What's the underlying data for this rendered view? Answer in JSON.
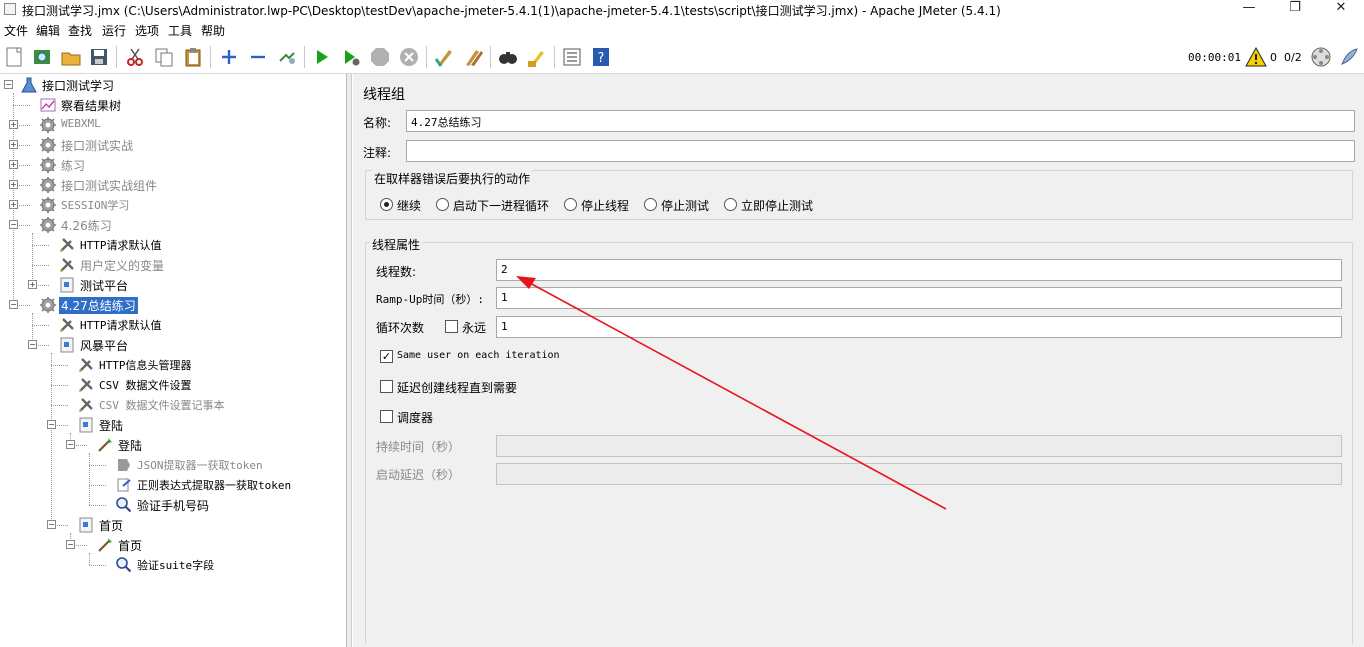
{
  "window": {
    "title": "接口测试学习.jmx (C:\\Users\\Administrator.lwp-PC\\Desktop\\testDev\\apache-jmeter-5.4.1(1)\\apache-jmeter-5.4.1\\tests\\script\\接口测试学习.jmx) - Apache JMeter (5.4.1)",
    "minimize": "—",
    "maximize": "❐",
    "close": "✕"
  },
  "menu": [
    "文件",
    "编辑",
    "查找",
    "运行",
    "选项",
    "工具",
    "帮助"
  ],
  "toolbar": {
    "icons": [
      "new-icon",
      "templates-icon",
      "open-icon",
      "save-icon",
      "cut-icon",
      "copy-icon",
      "paste-icon",
      "expand-icon",
      "collapse-icon",
      "toggle-icon",
      "start-icon",
      "start-no-pause-icon",
      "stop-icon",
      "shutdown-icon",
      "clear-icon",
      "clear-all-icon",
      "search-icon",
      "reset-search-icon",
      "function-helper-icon",
      "help-icon"
    ],
    "elapsed": "00:00:01",
    "warnings": "0",
    "threads": "0/2"
  },
  "tree": {
    "nodes": [
      {
        "label": "接口测试学习",
        "icon": "test-plan-icon",
        "depth": 0,
        "expander": "−",
        "style": "normal"
      },
      {
        "label": "察看结果树",
        "icon": "listener-icon",
        "depth": 1,
        "expander": "",
        "style": "normal"
      },
      {
        "label": "WEBXML",
        "icon": "thread-group-icon",
        "depth": 1,
        "expander": "+",
        "style": "disabled"
      },
      {
        "label": "接口测试实战",
        "icon": "thread-group-icon",
        "depth": 1,
        "expander": "+",
        "style": "disabled"
      },
      {
        "label": "练习",
        "icon": "thread-group-icon",
        "depth": 1,
        "expander": "+",
        "style": "disabled"
      },
      {
        "label": "接口测试实战组件",
        "icon": "thread-group-icon",
        "depth": 1,
        "expander": "+",
        "style": "disabled"
      },
      {
        "label": "SESSION学习",
        "icon": "thread-group-icon",
        "depth": 1,
        "expander": "+",
        "style": "disabled"
      },
      {
        "label": "4.26练习",
        "icon": "thread-group-icon",
        "depth": 1,
        "expander": "−",
        "style": "disabled"
      },
      {
        "label": "HTTP请求默认值",
        "icon": "config-icon",
        "depth": 2,
        "expander": "",
        "style": "normal"
      },
      {
        "label": "用户定义的变量",
        "icon": "config-icon",
        "depth": 2,
        "expander": "",
        "style": "disabled"
      },
      {
        "label": "测试平台",
        "icon": "controller-icon",
        "depth": 2,
        "expander": "+",
        "style": "normal"
      },
      {
        "label": "4.27总结练习",
        "icon": "thread-group-icon",
        "depth": 1,
        "expander": "−",
        "style": "selected"
      },
      {
        "label": "HTTP请求默认值",
        "icon": "config-icon",
        "depth": 2,
        "expander": "",
        "style": "normal"
      },
      {
        "label": "风暴平台",
        "icon": "controller-icon",
        "depth": 2,
        "expander": "−",
        "style": "normal"
      },
      {
        "label": "HTTP信息头管理器",
        "icon": "config-icon",
        "depth": 3,
        "expander": "",
        "style": "normal"
      },
      {
        "label": "CSV 数据文件设置",
        "icon": "config-icon",
        "depth": 3,
        "expander": "",
        "style": "normal"
      },
      {
        "label": "CSV 数据文件设置记事本",
        "icon": "config-icon",
        "depth": 3,
        "expander": "",
        "style": "disabled"
      },
      {
        "label": "登陆",
        "icon": "controller-icon",
        "depth": 3,
        "expander": "−",
        "style": "normal"
      },
      {
        "label": "登陆",
        "icon": "sampler-icon",
        "depth": 4,
        "expander": "−",
        "style": "normal"
      },
      {
        "label": "JSON提取器一获取token",
        "icon": "extractor-icon",
        "depth": 5,
        "expander": "",
        "style": "disabled"
      },
      {
        "label": "正则表达式提取器一获取token",
        "icon": "regex-extractor-icon",
        "depth": 5,
        "expander": "",
        "style": "normal"
      },
      {
        "label": "验证手机号码",
        "icon": "assertion-icon",
        "depth": 5,
        "expander": "",
        "style": "normal"
      },
      {
        "label": "首页",
        "icon": "controller-icon",
        "depth": 3,
        "expander": "−",
        "style": "normal"
      },
      {
        "label": "首页",
        "icon": "sampler-icon",
        "depth": 4,
        "expander": "−",
        "style": "normal"
      },
      {
        "label": "验证suite字段",
        "icon": "assertion-icon",
        "depth": 5,
        "expander": "",
        "style": "normal"
      }
    ]
  },
  "form": {
    "heading": "线程组",
    "name_label": "名称:",
    "name_value": "4.27总结练习",
    "comment_label": "注释:",
    "comment_value": "",
    "error_group_title": "在取样器错误后要执行的动作",
    "error_actions": [
      {
        "label": "继续",
        "selected": true
      },
      {
        "label": "启动下一进程循环",
        "selected": false
      },
      {
        "label": "停止线程",
        "selected": false
      },
      {
        "label": "停止测试",
        "selected": false
      },
      {
        "label": "立即停止测试",
        "selected": false
      }
    ],
    "props_title": "线程属性",
    "threads_label": "线程数:",
    "threads_value": "2",
    "rampup_label": "Ramp-Up时间（秒）:",
    "rampup_value": "1",
    "loop_label": "循环次数",
    "forever_label": "永远",
    "forever_checked": false,
    "loop_value": "1",
    "same_user_label": "Same user on each iteration",
    "same_user_checked": true,
    "delay_label": "延迟创建线程直到需要",
    "delay_checked": false,
    "scheduler_label": "调度器",
    "scheduler_checked": false,
    "duration_label": "持续时间（秒）",
    "duration_value": "",
    "startup_delay_label": "启动延迟（秒）",
    "startup_delay_value": ""
  },
  "colors": {
    "selection": "#2f6fc8",
    "panel_bg": "#f0f0f0",
    "annotation_arrow": "#e8141a"
  }
}
